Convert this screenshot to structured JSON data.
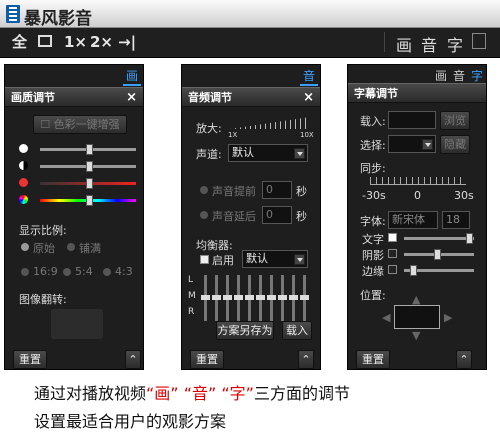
{
  "app": {
    "title": "暴风影音"
  },
  "toolbar": {
    "full": "全",
    "mini": "",
    "x1": "1×",
    "x2": "2×",
    "pin": "",
    "pic": "画",
    "sound": "音",
    "sub": "字"
  },
  "tabs": {
    "pic": "画",
    "sound": "音",
    "sub": "字"
  },
  "picture": {
    "title": "画质调节",
    "enhance": "色彩一键增强",
    "ratio_label": "显示比例:",
    "orig": "原始",
    "fill": "铺满",
    "r1": "16:9",
    "r2": "5:4",
    "r3": "4:3",
    "flip_label": "图像翻转:",
    "reset": "重置"
  },
  "audio": {
    "title": "音频调节",
    "amp": "放大:",
    "amp_min": "1X",
    "amp_max": "10X",
    "channel_label": "声道:",
    "channel_value": "默认",
    "adv": "声音提前",
    "adv_val": "0",
    "sec1": "秒",
    "delay": "声音延后",
    "delay_val": "0",
    "sec2": "秒",
    "eq_label": "均衡器:",
    "eq_enable": "启用",
    "eq_preset": "默认",
    "L": "L",
    "M": "M",
    "R": "R",
    "save_btn": "方案另存为",
    "load_btn": "载入",
    "reset": "重置"
  },
  "subtitle": {
    "title": "字幕调节",
    "load": "载入:",
    "browse": "浏览",
    "select": "选择:",
    "hide": "隐藏",
    "sync": "同步:",
    "sync_min": "-30s",
    "sync_mid": "0",
    "sync_max": "30s",
    "font": "字体:",
    "font_name": "新宋体",
    "font_size": "18",
    "text": "文字",
    "shadow": "阴影",
    "border": "边缘",
    "pos": "位置:",
    "reset": "重置"
  },
  "caption": {
    "line1_a": "通过对播放视频",
    "q1": "“画”",
    "q2": "“音”",
    "q3": "“字”",
    "line1_b": "三方面的调节",
    "line2": "设置最适合用户的观影方案"
  }
}
